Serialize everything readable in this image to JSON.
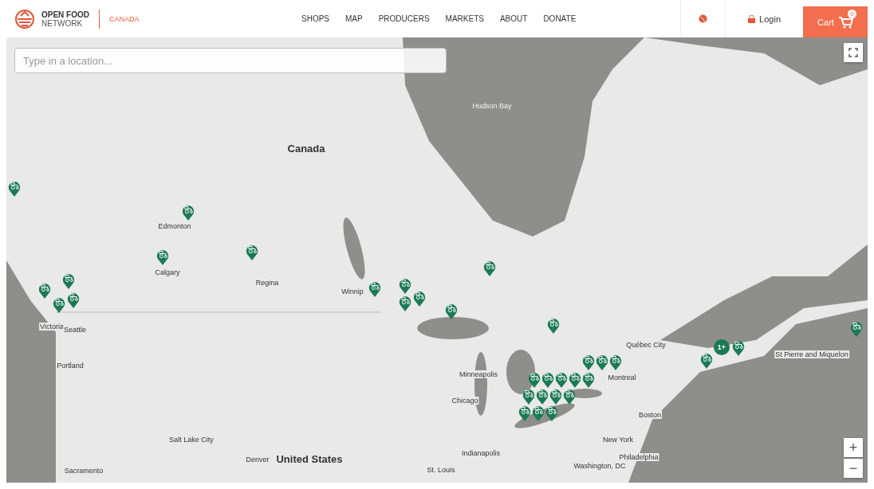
{
  "header": {
    "logo_line1": "OPEN FOOD",
    "logo_line2": "NETWORK",
    "region": "CANADA",
    "nav": [
      {
        "label": "SHOPS"
      },
      {
        "label": "MAP"
      },
      {
        "label": "PRODUCERS"
      },
      {
        "label": "MARKETS"
      },
      {
        "label": "ABOUT"
      },
      {
        "label": "DONATE"
      }
    ],
    "login": "Login",
    "cart": "Cart",
    "cart_count": "0"
  },
  "map": {
    "search": {
      "placeholder": "Type in a location..."
    },
    "labels": [
      {
        "text": "Canada",
        "kind": "country"
      },
      {
        "text": "Hudson Bay",
        "kind": "water"
      },
      {
        "text": "Edmonton",
        "kind": "city"
      },
      {
        "text": "Calgary",
        "kind": "city"
      },
      {
        "text": "Regina",
        "kind": "city"
      },
      {
        "text": "Winnip",
        "kind": "city"
      },
      {
        "text": "Victoria",
        "kind": "city"
      },
      {
        "text": "Seattle",
        "kind": "city"
      },
      {
        "text": "Portland",
        "kind": "city"
      },
      {
        "text": "Minneapolis",
        "kind": "city"
      },
      {
        "text": "Chicago",
        "kind": "city"
      },
      {
        "text": "Québec City",
        "kind": "city"
      },
      {
        "text": "Montreal",
        "kind": "city"
      },
      {
        "text": "Boston",
        "kind": "city"
      },
      {
        "text": "New York",
        "kind": "city"
      },
      {
        "text": "Philadelphia",
        "kind": "city"
      },
      {
        "text": "Washington, DC",
        "kind": "city"
      },
      {
        "text": "Indianapolis",
        "kind": "city"
      },
      {
        "text": "St. Louis",
        "kind": "city"
      },
      {
        "text": "Denver",
        "kind": "city"
      },
      {
        "text": "United States",
        "kind": "country"
      },
      {
        "text": "Salt Lake City",
        "kind": "city"
      },
      {
        "text": "Sacramento",
        "kind": "city"
      },
      {
        "text": "St Pierre and Miquelon",
        "kind": "city"
      }
    ],
    "cluster": "1+",
    "zoom_in": "+",
    "zoom_out": "−"
  }
}
